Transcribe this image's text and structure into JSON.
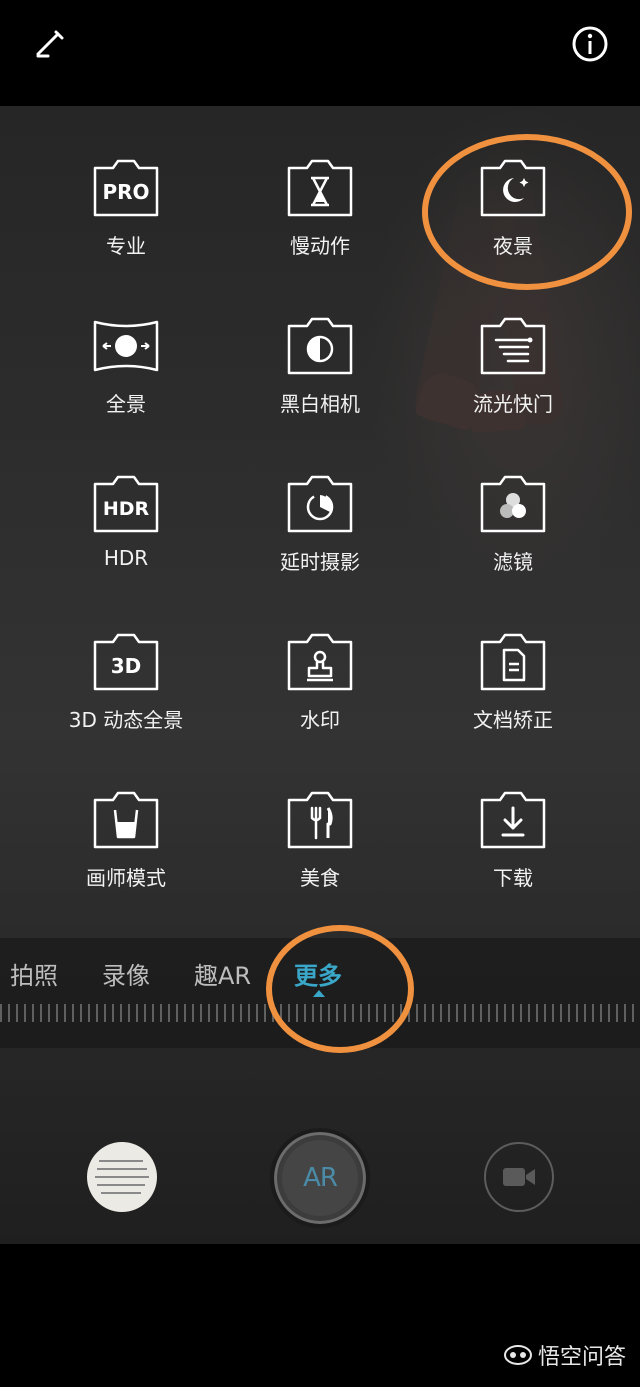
{
  "header": {
    "edit_icon": "edit-pencil-icon",
    "info_icon": "info-icon"
  },
  "modes": [
    {
      "label": "专业",
      "icon": "pro-icon",
      "badge": "PRO"
    },
    {
      "label": "慢动作",
      "icon": "hourglass-icon"
    },
    {
      "label": "夜景",
      "icon": "night-moon-icon"
    },
    {
      "label": "全景",
      "icon": "panorama-icon"
    },
    {
      "label": "黑白相机",
      "icon": "monochrome-icon"
    },
    {
      "label": "流光快门",
      "icon": "light-painting-icon"
    },
    {
      "label": "HDR",
      "icon": "hdr-icon",
      "badge": "HDR"
    },
    {
      "label": "延时摄影",
      "icon": "timelapse-icon"
    },
    {
      "label": "滤镜",
      "icon": "filter-icon"
    },
    {
      "label": "3D 动态全景",
      "icon": "3d-panorama-icon",
      "badge": "3D"
    },
    {
      "label": "水印",
      "icon": "watermark-stamp-icon"
    },
    {
      "label": "文档矫正",
      "icon": "document-icon"
    },
    {
      "label": "画师模式",
      "icon": "painter-cup-icon"
    },
    {
      "label": "美食",
      "icon": "food-fork-knife-icon"
    },
    {
      "label": "下载",
      "icon": "download-icon"
    }
  ],
  "tabs": [
    {
      "label": "拍照",
      "active": false
    },
    {
      "label": "录像",
      "active": false
    },
    {
      "label": "趣AR",
      "active": false
    },
    {
      "label": "更多",
      "active": true
    }
  ],
  "shutter_label": "AR",
  "controls": {
    "gallery_icon": "gallery-thumbnail",
    "video_icon": "video-camera-icon"
  },
  "watermark": {
    "text": "悟空问答",
    "icon": "wukong-logo-icon"
  },
  "colors": {
    "accent": "#3aa7c9",
    "highlight": "#f0913f",
    "background": "#000000"
  }
}
